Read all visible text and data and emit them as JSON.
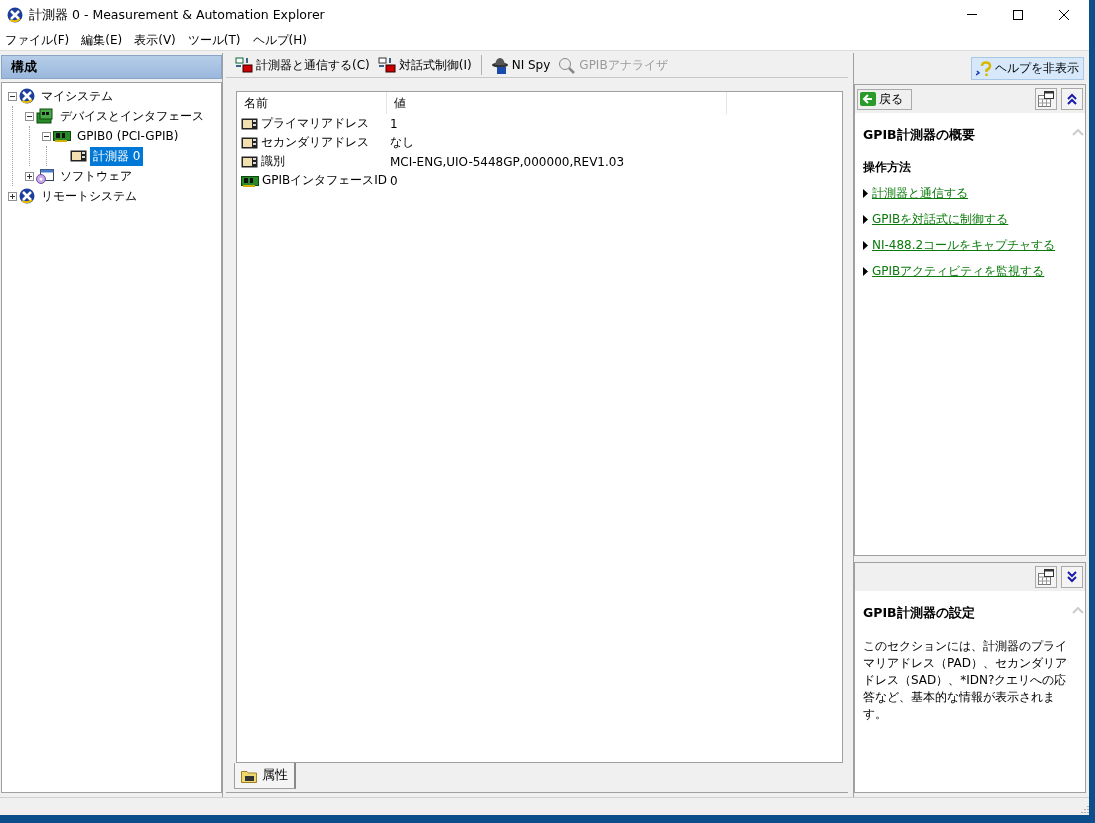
{
  "window": {
    "title": "計測器 0 - Measurement & Automation Explorer"
  },
  "menu": [
    "ファイル(F)",
    "編集(E)",
    "表示(V)",
    "ツール(T)",
    "ヘルプ(H)"
  ],
  "sidebar": {
    "title": "構成",
    "tree": [
      {
        "label": "マイシステム",
        "kind": "system",
        "expanded": true,
        "selected": false,
        "children": [
          {
            "label": "デバイスとインタフェース",
            "kind": "devices",
            "expanded": true,
            "selected": false,
            "children": [
              {
                "label": "GPIB0 (PCI-GPIB)",
                "kind": "board",
                "expanded": true,
                "selected": false,
                "children": [
                  {
                    "label": "計測器 0",
                    "kind": "instrument",
                    "selected": true
                  }
                ]
              }
            ]
          },
          {
            "label": "ソフトウェア",
            "kind": "software",
            "expanded": false,
            "selected": false
          }
        ]
      },
      {
        "label": "リモートシステム",
        "kind": "system",
        "expanded": false,
        "selected": false
      }
    ]
  },
  "toolbar": {
    "buttons": [
      {
        "label": "計測器と通信する(C)",
        "kind": "communicate",
        "disabled": false
      },
      {
        "label": "対話式制御(I)",
        "kind": "interactive",
        "disabled": false
      },
      {
        "label": "NI Spy",
        "kind": "spy",
        "disabled": false
      },
      {
        "label": "GPIBアナライザ",
        "kind": "analyzer",
        "disabled": true
      }
    ],
    "help_toggle": {
      "label": "ヘルプを非表示",
      "pressed": true
    }
  },
  "table": {
    "columns": [
      "名前",
      "値"
    ],
    "rows": [
      {
        "kind": "instrument",
        "name": "プライマリアドレス",
        "value": "1"
      },
      {
        "kind": "instrument",
        "name": "セカンダリアドレス",
        "value": "なし"
      },
      {
        "kind": "instrument",
        "name": "識別",
        "value": "MCI-ENG,UIO-5448GP,000000,REV1.03"
      },
      {
        "kind": "board",
        "name": "GPIBインタフェースID",
        "value": "0"
      }
    ]
  },
  "tabs": [
    {
      "label": "属性",
      "selected": true
    }
  ],
  "help": {
    "back": "戻る",
    "overview": {
      "title": "GPIB計測器の概要",
      "heading": "操作方法",
      "links": [
        "計測器と通信する",
        "GPIBを対話式に制御する",
        "NI-488.2コールをキャプチャする",
        "GPIBアクティビティを監視する"
      ]
    },
    "settings": {
      "title": "GPIB計測器の設定",
      "text": "このセクションには、計測器のプライマリアドレス（PAD）、セカンダリアドレス（SAD）、*IDN?クエリへの応答など、基本的な情報が表示されます。"
    }
  }
}
